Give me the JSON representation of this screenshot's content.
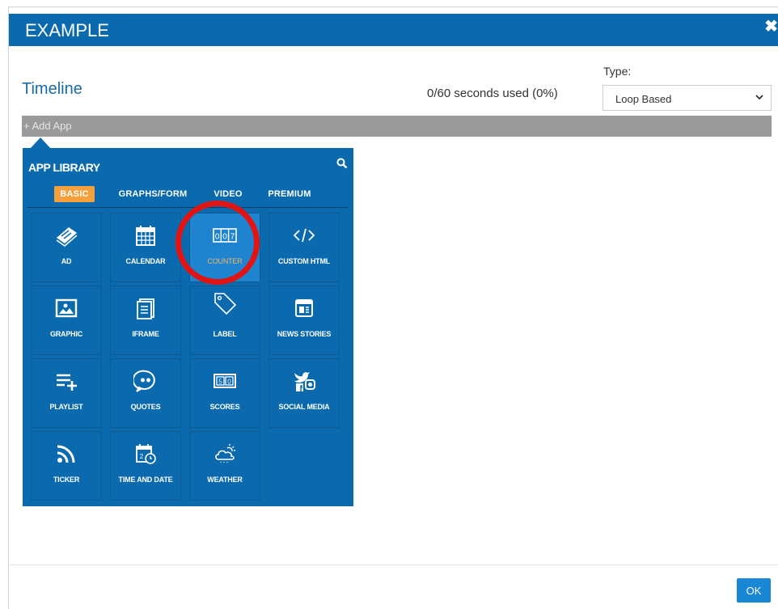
{
  "dialog": {
    "title": "EXAMPLE",
    "close_label": "✖",
    "ok_label": "OK"
  },
  "timeline": {
    "title": "Timeline",
    "seconds_used": "0/60 seconds used (0%)",
    "type_label": "Type:",
    "type_value": "Loop Based",
    "add_app_label": "+ Add App"
  },
  "library": {
    "title": "APP LIBRARY",
    "tabs": [
      {
        "label": "BASIC",
        "active": true
      },
      {
        "label": "GRAPHS/FORM",
        "active": false
      },
      {
        "label": "VIDEO",
        "active": false
      },
      {
        "label": "PREMIUM",
        "active": false
      }
    ],
    "apps": [
      {
        "label": "AD",
        "icon": "ad-icon"
      },
      {
        "label": "CALENDAR",
        "icon": "calendar-icon"
      },
      {
        "label": "COUNTER",
        "icon": "counter-icon",
        "selected": true
      },
      {
        "label": "CUSTOM HTML",
        "icon": "code-icon"
      },
      {
        "label": "GRAPHIC",
        "icon": "image-icon"
      },
      {
        "label": "IFRAME",
        "icon": "iframe-icon"
      },
      {
        "label": "LABEL",
        "icon": "tag-icon"
      },
      {
        "label": "NEWS STORIES",
        "icon": "news-icon"
      },
      {
        "label": "PLAYLIST",
        "icon": "playlist-icon"
      },
      {
        "label": "QUOTES",
        "icon": "quotes-icon"
      },
      {
        "label": "SCORES",
        "icon": "scoreboard-icon"
      },
      {
        "label": "SOCIAL MEDIA",
        "icon": "social-icon"
      },
      {
        "label": "TICKER",
        "icon": "rss-icon"
      },
      {
        "label": "TIME AND DATE",
        "icon": "time-date-icon"
      },
      {
        "label": "WEATHER",
        "icon": "weather-icon"
      }
    ]
  },
  "colors": {
    "brand_blue": "#0a6aad",
    "active_tab": "#f5a03c",
    "highlight": "#e11414"
  }
}
